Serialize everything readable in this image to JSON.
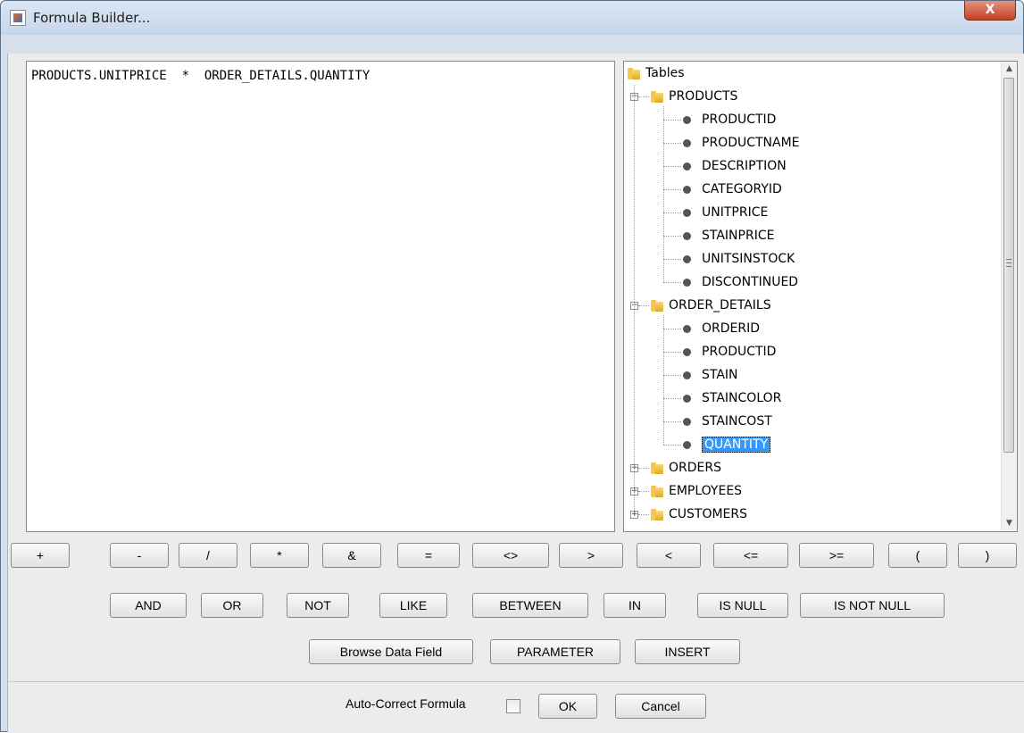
{
  "window": {
    "title": "Formula Builder...",
    "close_glyph": "X"
  },
  "editor": {
    "formula": "PRODUCTS.UNITPRICE  *  ORDER_DETAILS.QUANTITY"
  },
  "tree": {
    "root_label": "Tables",
    "tables": [
      {
        "name": "PRODUCTS",
        "expanded": true,
        "fields": [
          "PRODUCTID",
          "PRODUCTNAME",
          "DESCRIPTION",
          "CATEGORYID",
          "UNITPRICE",
          "STAINPRICE",
          "UNITSINSTOCK",
          "DISCONTINUED"
        ]
      },
      {
        "name": "ORDER_DETAILS",
        "expanded": true,
        "fields": [
          "ORDERID",
          "PRODUCTID",
          "STAIN",
          "STAINCOLOR",
          "STAINCOST",
          "QUANTITY"
        ],
        "selected_field": "QUANTITY"
      },
      {
        "name": "ORDERS",
        "expanded": false,
        "fields": []
      },
      {
        "name": "EMPLOYEES",
        "expanded": false,
        "fields": []
      },
      {
        "name": "CUSTOMERS",
        "expanded": false,
        "fields": []
      }
    ],
    "scroll_up_glyph": "▲",
    "scroll_down_glyph": "▼"
  },
  "operators": [
    "+",
    "-",
    "/",
    "*",
    "&",
    "=",
    "<>",
    ">",
    "<",
    "<=",
    ">=",
    "(",
    ")"
  ],
  "logical": [
    "AND",
    "OR",
    "NOT",
    "LIKE",
    "BETWEEN",
    "IN",
    "IS NULL",
    "IS NOT NULL"
  ],
  "actions": [
    "Browse Data Field",
    "PARAMETER",
    "INSERT"
  ],
  "footer": {
    "auto_correct_label": "Auto-Correct Formula",
    "auto_correct_checked": false,
    "ok_label": "OK",
    "cancel_label": "Cancel"
  },
  "colors": {
    "selection": "#3399ff",
    "close_button": "#c44224",
    "titlebar": "#c6d6ea"
  }
}
